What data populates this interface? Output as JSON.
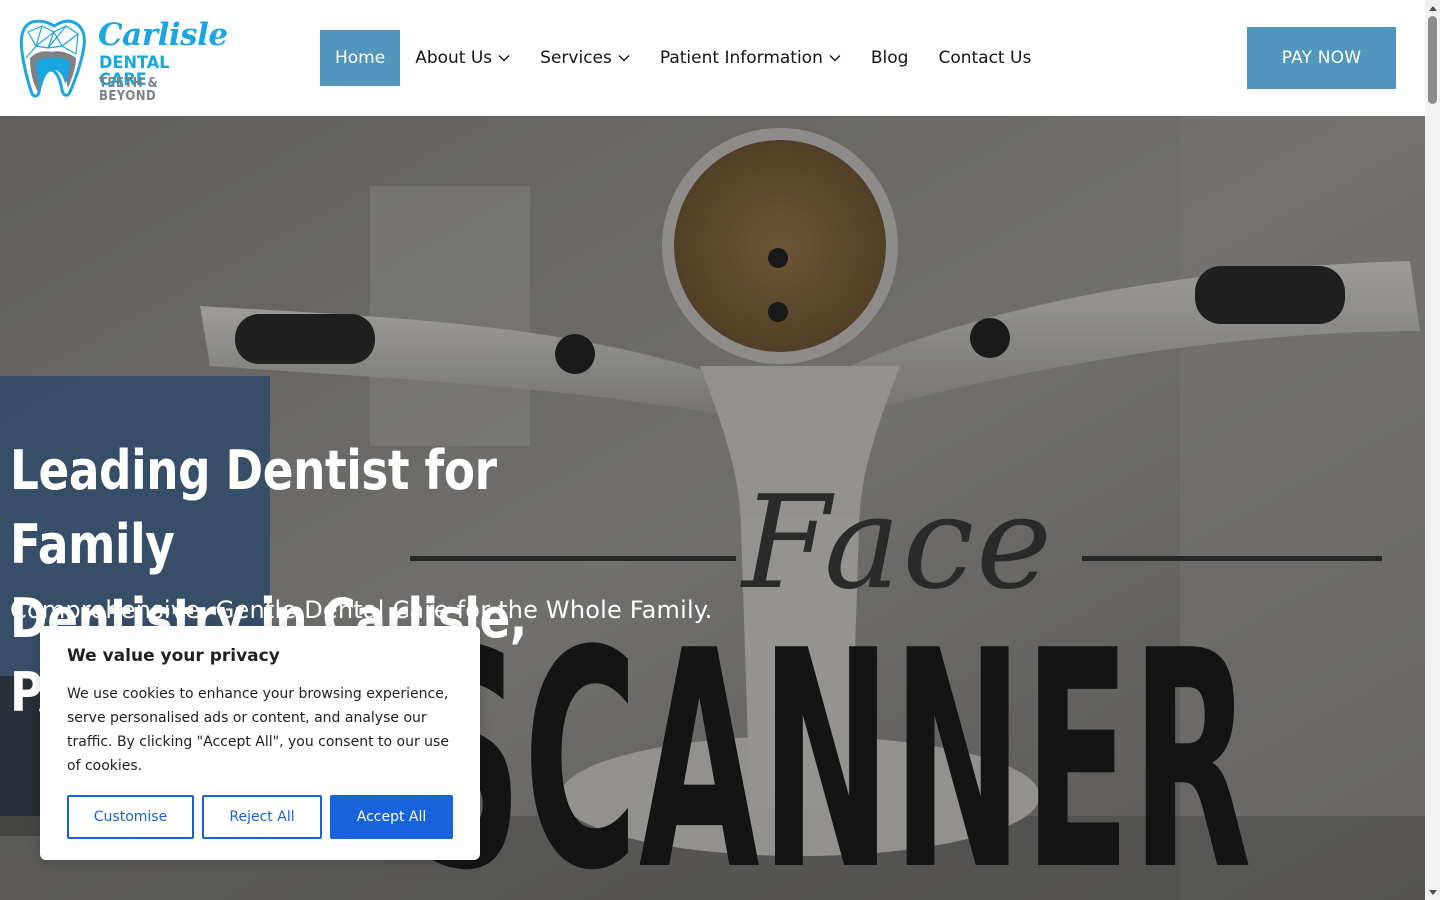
{
  "logo": {
    "name": "Carlisle",
    "line2": "DENTAL CARE",
    "line3": "TEETH & BEYOND"
  },
  "nav": {
    "items": [
      {
        "label": "Home",
        "active": true,
        "dropdown": false
      },
      {
        "label": "About Us",
        "active": false,
        "dropdown": true
      },
      {
        "label": "Services",
        "active": false,
        "dropdown": true
      },
      {
        "label": "Patient Information",
        "active": false,
        "dropdown": true
      },
      {
        "label": "Blog",
        "active": false,
        "dropdown": false
      },
      {
        "label": "Contact Us",
        "active": false,
        "dropdown": false
      }
    ]
  },
  "header": {
    "pay_button": "PAY NOW"
  },
  "hero": {
    "title_line1": "Leading Dentist for Family",
    "title_line2": "Dentistry in Carlisle, PA",
    "subtitle": "Comprehensive, Gentle Dental Care for the Whole Family.",
    "image_text_face": "Face",
    "image_text_scanner": "SCANNER"
  },
  "cookie": {
    "title": "We value your privacy",
    "body": "We use cookies to enhance your browsing experience, serve personalised ads or content, and analyse our traffic. By clicking \"Accept All\", you consent to our use of cookies.",
    "customise": "Customise",
    "reject": "Reject All",
    "accept": "Accept All"
  },
  "colors": {
    "brand_blue": "#5196bd",
    "logo_blue": "#1aa6e0",
    "cookie_blue": "#1863dc"
  },
  "icons": {
    "dropdown": "chevron-down-icon",
    "logo": "tooth-logo-icon"
  }
}
